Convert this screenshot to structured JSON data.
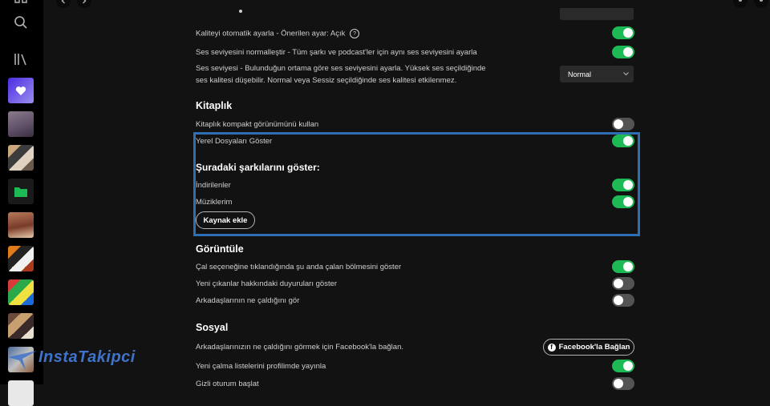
{
  "sidebar": {
    "home_icon": "home-icon",
    "search_icon": "search-icon",
    "library_icon": "library-icon"
  },
  "settings": {
    "auto_quality_label": "Kaliteyi otomatik ayarla - Önerilen ayar: Açık",
    "auto_quality_on": true,
    "normalize_label": "Ses seviyesini normalleştir - Tüm şarkı ve podcast'ler için aynı ses seviyesini ayarla",
    "normalize_on": true,
    "volume_level_label": "Ses seviyesi - Bulunduğun ortama göre ses seviyesini ayarla. Yüksek ses seçildiğinde ses kalitesi düşebilir. Normal veya Sessiz seçildiğinde ses kalitesi etkilenmez.",
    "volume_level_value": "Normal",
    "library_title": "Kitaplık",
    "compact_label": "Kitaplık kompakt görünümünü kullan",
    "compact_on": false,
    "local_files_label": "Yerel Dosyaları Göster",
    "local_files_on": true,
    "sources_title": "Şuradaki şarkılarını göster:",
    "downloads_label": "İndirilenler",
    "downloads_on": true,
    "music_label": "Müziklerim",
    "music_on": true,
    "add_source_label": "Kaynak ekle",
    "display_title": "Görüntüle",
    "now_playing_label": "Çal seçeneğine tıklandığında şu anda çalan bölmesini göster",
    "now_playing_on": true,
    "releases_label": "Yeni çıkanlar hakkındaki duyuruları göster",
    "releases_on": false,
    "friends_label": "Arkadaşlarının ne çaldığını gör",
    "friends_on": false,
    "social_title": "Sosyal",
    "facebook_label": "Arkadaşlarınızın ne çaldığını görmek için Facebook'la bağlan.",
    "facebook_button": "Facebook'la Bağlan",
    "new_playlists_label": "Yeni çalma listelerini profilimde yayınla",
    "new_playlists_on": true,
    "private_session_label": "Gizli oturum başlat",
    "private_session_on": false
  },
  "watermark": {
    "text": "InstaTakipci"
  },
  "colors": {
    "accent": "#1db954",
    "highlight": "#2f6db5",
    "background": "#121212"
  }
}
